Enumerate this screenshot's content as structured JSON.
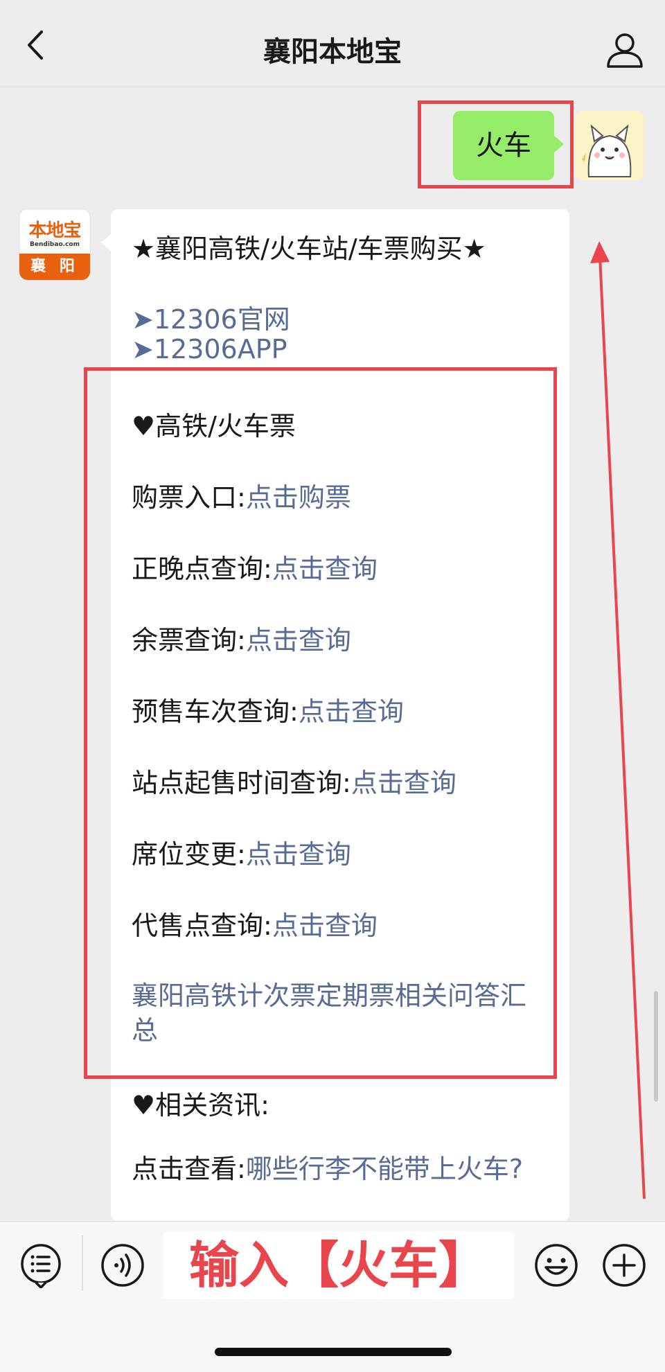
{
  "header": {
    "title": "襄阳本地宝"
  },
  "my_message": {
    "text": "火车"
  },
  "bot_avatar": {
    "logo": "本地宝",
    "url": "Bendibao.com",
    "city": "襄 阳"
  },
  "bot_message": {
    "heading": "★襄阳高铁/火车站/车票购买★",
    "links": [
      "➤12306官网",
      "➤12306APP"
    ],
    "section1_title": "♥高铁/火车票",
    "items": [
      {
        "label": "购票入口:",
        "link": "点击购票"
      },
      {
        "label": "正晚点查询:",
        "link": "点击查询"
      },
      {
        "label": "余票查询:",
        "link": "点击查询"
      },
      {
        "label": "预售车次查询:",
        "link": "点击查询"
      },
      {
        "label": "站点起售时间查询:",
        "link": "点击查询"
      },
      {
        "label": "席位变更:",
        "link": "点击查询"
      },
      {
        "label": "代售点查询:",
        "link": "点击查询"
      }
    ],
    "summary_link": "襄阳高铁计次票定期票相关问答汇总",
    "section2_title": "♥相关资讯:",
    "news": {
      "label": "点击查看:",
      "link": "哪些行李不能带上火车?"
    }
  },
  "input": {
    "annotation": "输入【火车】"
  },
  "colors": {
    "annotation_red": "#e8454d",
    "link_blue": "#576b95",
    "bubble_green": "#95ec69",
    "brand_orange": "#e9600e"
  },
  "icons": [
    "back-icon",
    "profile-icon",
    "menu-icon",
    "voice-icon",
    "emoji-icon",
    "plus-icon"
  ]
}
